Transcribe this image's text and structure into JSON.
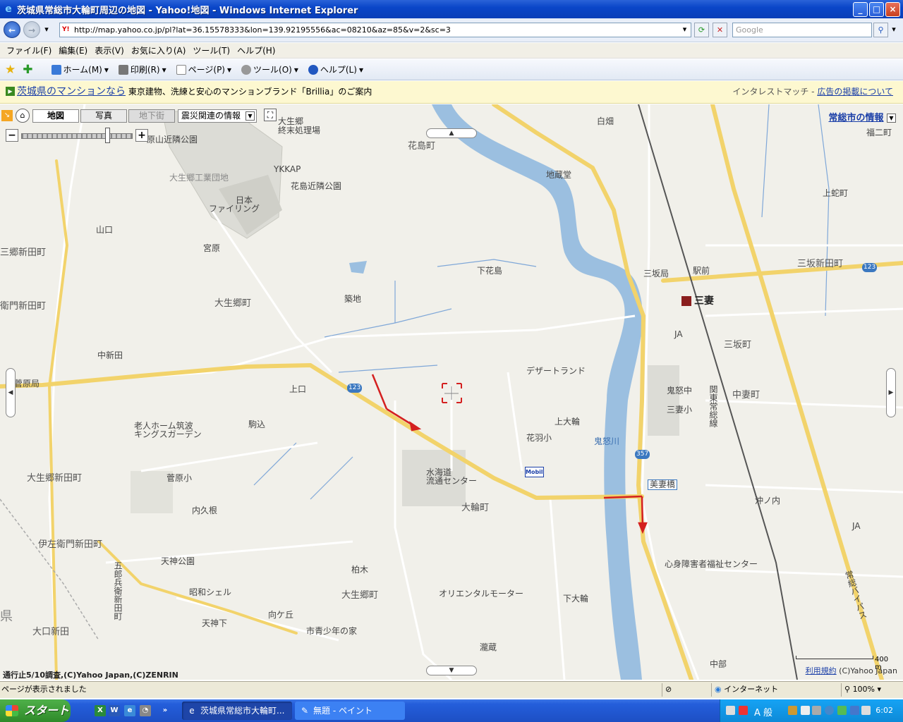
{
  "window": {
    "title": "茨城県常総市大輪町周辺の地図 - Yahoo!地図 - Windows Internet Explorer",
    "min": "_",
    "max": "□",
    "close": "×"
  },
  "address": {
    "url": "http://map.yahoo.co.jp/pl?lat=36.15578333&lon=139.92195556&ac=08210&az=85&v=2&sc=3",
    "search_placeholder": "Google",
    "favicon": "Y!"
  },
  "menu": [
    "ファイル(F)",
    "編集(E)",
    "表示(V)",
    "お気に入り(A)",
    "ツール(T)",
    "ヘルプ(H)"
  ],
  "commands": {
    "home": "ホーム(M)",
    "print": "印刷(R)",
    "page": "ページ(P)",
    "tools": "ツール(O)",
    "help": "ヘルプ(L)"
  },
  "ad": {
    "link": "茨城県のマンションなら",
    "text": "東京建物、洗練と安心のマンションブランド「Brillia」のご案内",
    "right_label": "インタレストマッチ",
    "right_sep": "-",
    "right_link": "広告の掲載について"
  },
  "map_tabs": {
    "map": "地図",
    "photo": "写真",
    "underground": "地下街",
    "disaster": "震災関連の情報",
    "city_info": "常総市の情報"
  },
  "labels": {
    "ooikugo_shumatsu": "大生郷\n終末処理場",
    "haramayama_park": "原山近隣公園",
    "ykkap": "YKKAP",
    "hanashima_park": "花島近隣公園",
    "industrial": "大生郷工業団地",
    "nihon_filing_1": "日本",
    "nihon_filing_2": "ファイリング",
    "hanashima": "花島町",
    "jizodo": "地蔵堂",
    "shirahata": "白畑",
    "fukuni": "福二町",
    "kamihebi": "上蛇町",
    "yamaguchi": "山口",
    "miyahara": "宮原",
    "ooikugo_shinden_left": "三郷新田町",
    "shimohanashima": "下花島",
    "misaka_po": "三坂局",
    "ekimae": "駅前",
    "misaka_shinden": "三坂新田町",
    "route123_right": "123",
    "chikuchi": "築地",
    "ooikugo": "大生郷町",
    "mitsukaido_station": "三妻",
    "left_shinden": "衛門新田町",
    "ja1": "JA",
    "misaka": "三坂町",
    "naka_shinden": "中新田",
    "desert_land": "デザートランド",
    "sugawara_po": "菅原局",
    "kamiguchi": "上口",
    "route123": "123",
    "kinu_chu": "鬼怒中",
    "mitsuma_sho": "三妻小",
    "nakatsuma": "中妻町",
    "kanto_joso": "関東常総線",
    "komagome": "駒込",
    "rojin_home_1": "老人ホーム筑波",
    "rojin_home_2": "キングスガーデン",
    "kamioowa": "上大輪",
    "hanyu_sho": "花羽小",
    "kinugawa": "鬼怒川",
    "route357": "357",
    "mobil": "Mobil",
    "suikaido_1": "水海道",
    "suikaido_2": "流通センター",
    "mitsuma_bridge": "美妻橋",
    "ooikugo_shinden": "大生郷新田町",
    "sugawara_sho": "菅原小",
    "oowa": "大輪町",
    "okinouchi": "沖ノ内",
    "uchikune": "内久根",
    "ja2": "JA",
    "iyoemon": "伊左衛門新田町",
    "tenjin_park": "天神公園",
    "gorobei_vert": "五郎兵衛新田町",
    "kashiwagi": "柏木",
    "shinshin": "心身障害者福祉センター",
    "joso_bypass": "常総バイパス",
    "showa_shell": "昭和シェル",
    "oriental_motor": "オリエンタルモーター",
    "ooikugo2": "大生郷町",
    "shimooowa": "下大輪",
    "mukaigaoka": "向ケ丘",
    "tenjinshita": "天神下",
    "shiseishonen": "市青少年の家",
    "taguchi_shinden": "大口新田",
    "nakabe": "中部",
    "takikura": "瀧蔵",
    "left_edge_ken": "県"
  },
  "map_footer": {
    "copyright": "通行止5/10調査,(C)Yahoo Japan,(C)ZENRIN",
    "terms": "利用規約",
    "credit": "(C)Yahoo Japan",
    "scale": "400 m"
  },
  "status": {
    "text": "ページが表示されました",
    "zone": "インターネット",
    "zoom": "100%"
  },
  "taskbar": {
    "start": "スタート",
    "item1": "茨城県常総市大輪町...",
    "item2": "無題 - ペイント",
    "lang": "A 般",
    "clock": "6:02"
  }
}
